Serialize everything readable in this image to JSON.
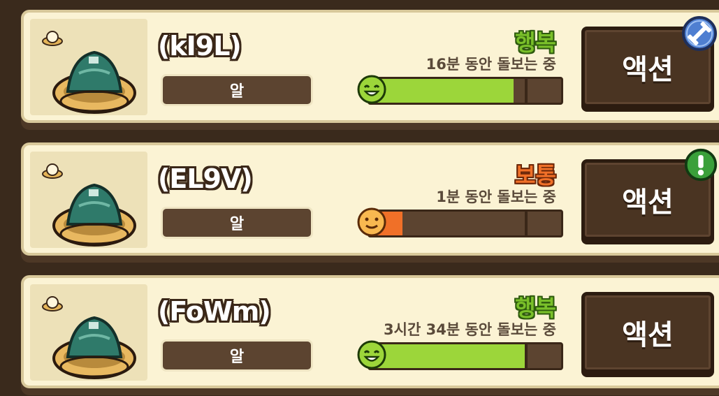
{
  "pets": [
    {
      "name": "(kI9L)",
      "type_label": "알",
      "mood_label": "행복",
      "mood_kind": "happy",
      "care_text": "16분 동안 돌보는 중",
      "mood_level": 0.75,
      "mood_color": "#9cd63a",
      "action_label": "액션",
      "badge": "dumbbell-icon"
    },
    {
      "name": "(EL9V)",
      "type_label": "알",
      "mood_label": "보통",
      "mood_kind": "normal",
      "care_text": "1분 동안 돌보는 중",
      "mood_level": 0.17,
      "mood_color": "#f07028",
      "action_label": "액션",
      "badge": "exclamation-icon"
    },
    {
      "name": "(FoWm)",
      "type_label": "알",
      "mood_label": "행복",
      "mood_kind": "happy",
      "care_text": "3시간 34분 동안 돌보는 중",
      "mood_level": 0.81,
      "mood_color": "#9cd63a",
      "action_label": "액션",
      "badge": ""
    }
  ]
}
